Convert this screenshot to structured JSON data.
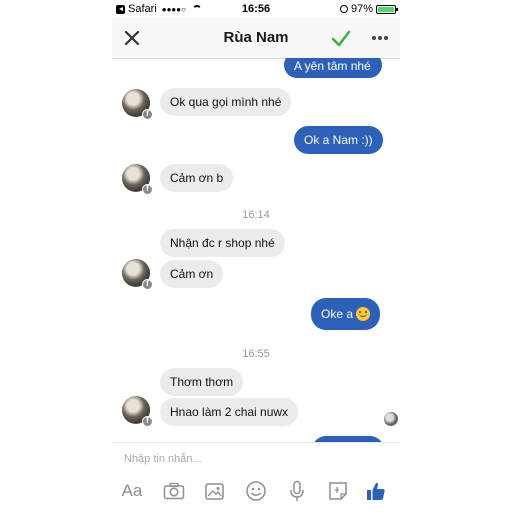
{
  "status_bar": {
    "carrier": "Safari",
    "signal": "●●●●○",
    "time": "16:56",
    "battery_percent": "97%",
    "battery_level": 0.97
  },
  "nav": {
    "title": "Rùa Nam"
  },
  "messages": [
    {
      "id": "m1",
      "direction": "out",
      "text": "A yên tâm nhé"
    },
    {
      "id": "m2",
      "direction": "in",
      "text": "Ok qua gọi mình nhé"
    },
    {
      "id": "m3",
      "direction": "out",
      "text": "Ok a Nam :))"
    },
    {
      "id": "m4",
      "direction": "in",
      "text": "Cảm ơn b"
    },
    {
      "id": "m5",
      "direction": "in",
      "text": "Nhận đc r shop nhé"
    },
    {
      "id": "m6",
      "direction": "in",
      "text": "Cảm ơn"
    },
    {
      "id": "m7",
      "direction": "out",
      "text": "Oke a",
      "emoji": "smiling-face"
    },
    {
      "id": "m8",
      "direction": "in",
      "text": "Thơm thơm"
    },
    {
      "id": "m9",
      "direction": "in",
      "text": "Hnao làm 2 chai nuwx"
    },
    {
      "id": "m10",
      "direction": "out",
      "text": ""
    }
  ],
  "timestamps": [
    "16:14",
    "16:55"
  ],
  "composer": {
    "placeholder": "Nhập tin nhắn...",
    "aa_label": "Aa"
  },
  "colors": {
    "outgoing_bubble": "#2d60b8",
    "incoming_bubble": "#ebebeb",
    "accent_check": "#3cb043",
    "like_button": "#2d60b8"
  }
}
